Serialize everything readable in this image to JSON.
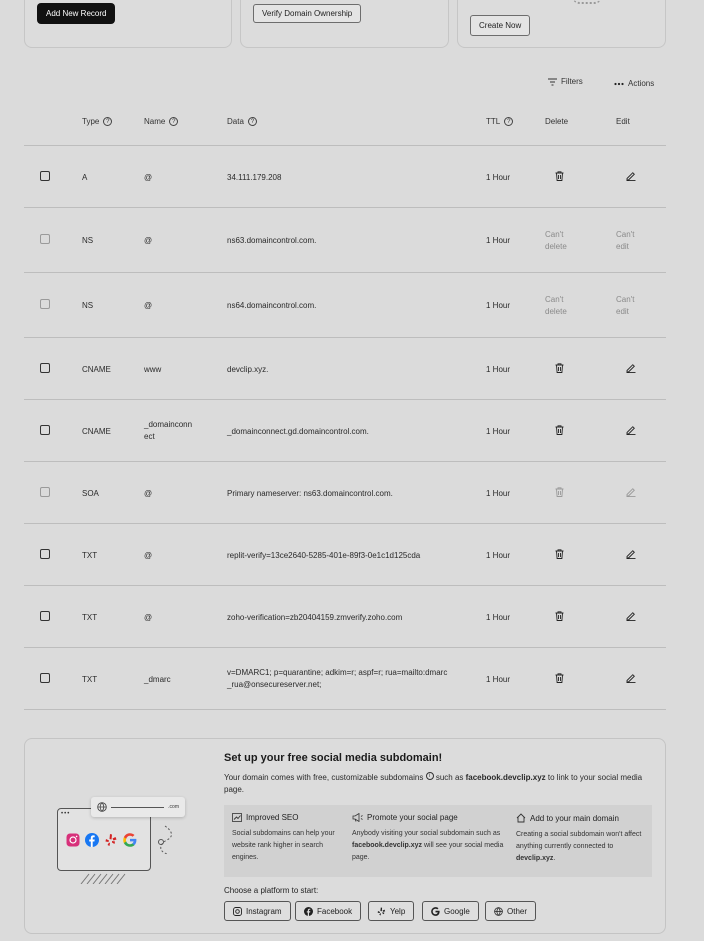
{
  "top_cards": {
    "add_record_label": "Add New Record",
    "verify_label": "Verify Domain Ownership",
    "create_label": "Create Now"
  },
  "toolbar": {
    "filters_label": "Filters",
    "actions_label": "Actions"
  },
  "table": {
    "headers": {
      "type": "Type",
      "name": "Name",
      "data": "Data",
      "ttl": "TTL",
      "delete": "Delete",
      "edit": "Edit"
    },
    "cant_delete": [
      "Can't",
      "delete"
    ],
    "cant_edit": [
      "Can't",
      "edit"
    ],
    "rows": [
      {
        "type": "A",
        "name": "@",
        "data": "34.111.179.208",
        "ttl": "1 Hour",
        "editable": true
      },
      {
        "type": "NS",
        "name": "@",
        "data": "ns63.domaincontrol.com.",
        "ttl": "1 Hour",
        "editable": false
      },
      {
        "type": "NS",
        "name": "@",
        "data": "ns64.domaincontrol.com.",
        "ttl": "1 Hour",
        "editable": false
      },
      {
        "type": "CNAME",
        "name": "www",
        "data": "devclip.xyz.",
        "ttl": "1 Hour",
        "editable": true
      },
      {
        "type": "CNAME",
        "name": "_domainconn",
        "name2": "ect",
        "data": "_domainconnect.gd.domaincontrol.com.",
        "ttl": "1 Hour",
        "editable": true
      },
      {
        "type": "SOA",
        "name": "@",
        "data": "Primary nameserver: ns63.domaincontrol.com.",
        "ttl": "1 Hour",
        "editable": "disabled"
      },
      {
        "type": "TXT",
        "name": "@",
        "data": "replit-verify=13ce2640-5285-401e-89f3-0e1c1d125cda",
        "ttl": "1 Hour",
        "editable": true
      },
      {
        "type": "TXT",
        "name": "@",
        "data": "zoho-verification=zb20404159.zmverify.zoho.com",
        "ttl": "1 Hour",
        "editable": true
      },
      {
        "type": "TXT",
        "name": "_dmarc",
        "data": "v=DMARC1; p=quarantine; adkim=r; aspf=r; rua=mailto:dmarc",
        "data2": "_rua@onsecureserver.net;",
        "ttl": "1 Hour",
        "editable": true
      }
    ]
  },
  "promo": {
    "title": "Set up your free social media subdomain!",
    "desc_pre": "Your domain comes with free, customizable subdomains",
    "desc_mid": " such as ",
    "desc_bold": "facebook.devclip.xyz",
    "desc_post": " to link to your social media",
    "desc_line2": "page.",
    "illustration_url": ".com",
    "features": [
      {
        "title": "Improved SEO",
        "icon": "trend-up-icon",
        "lines": [
          "Social subdomains can help your",
          "website rank higher in search",
          "engines."
        ]
      },
      {
        "title": "Promote your social page",
        "icon": "megaphone-icon",
        "lines": [
          "Anybody visiting your social subdomain such as",
          "will see your social media",
          "page."
        ],
        "bold": "facebook.devclip.xyz"
      },
      {
        "title": "Add to your main domain",
        "icon": "home-icon",
        "lines": [
          "Creating a social subdomain won't affect",
          "anything currently connected to",
          "."
        ],
        "bold": "devclip.xyz"
      }
    ],
    "choose_label": "Choose a platform to start:",
    "platforms": [
      "Instagram",
      "Facebook",
      "Yelp",
      "Google",
      "Other"
    ]
  }
}
